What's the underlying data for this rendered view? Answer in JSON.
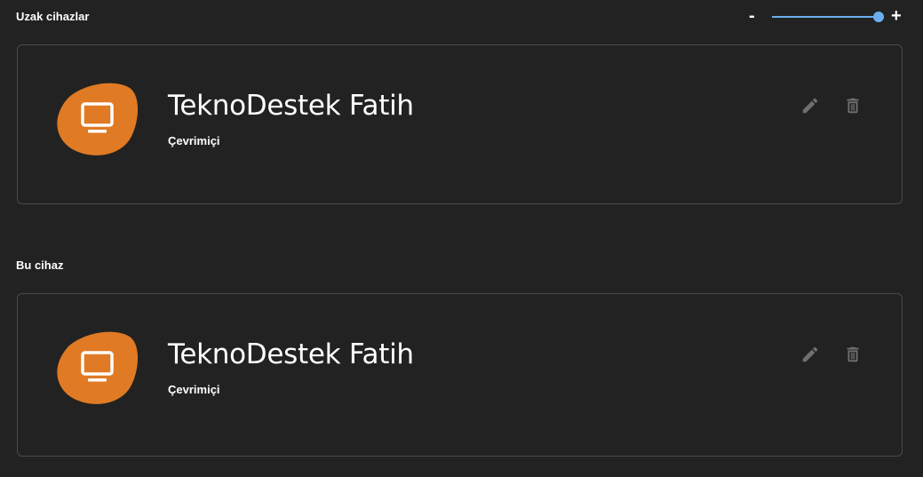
{
  "remote_section": {
    "label": "Uzak cihazlar"
  },
  "zoom": {
    "minus_label": "-",
    "plus_label": "+",
    "level": 1.0,
    "accent_color": "#6aaef0"
  },
  "remote_devices": [
    {
      "name": "TeknoDestek Fatih",
      "status": "Çevrimiçi",
      "icon": "monitor-icon",
      "avatar_color": "#e07a24"
    }
  ],
  "local_section": {
    "label": "Bu cihaz"
  },
  "local_devices": [
    {
      "name": "TeknoDestek Fatih",
      "status": "Çevrimiçi",
      "icon": "monitor-icon",
      "avatar_color": "#e07a24"
    }
  ],
  "actions": {
    "edit_icon": "pencil-icon",
    "delete_icon": "trash-icon"
  }
}
